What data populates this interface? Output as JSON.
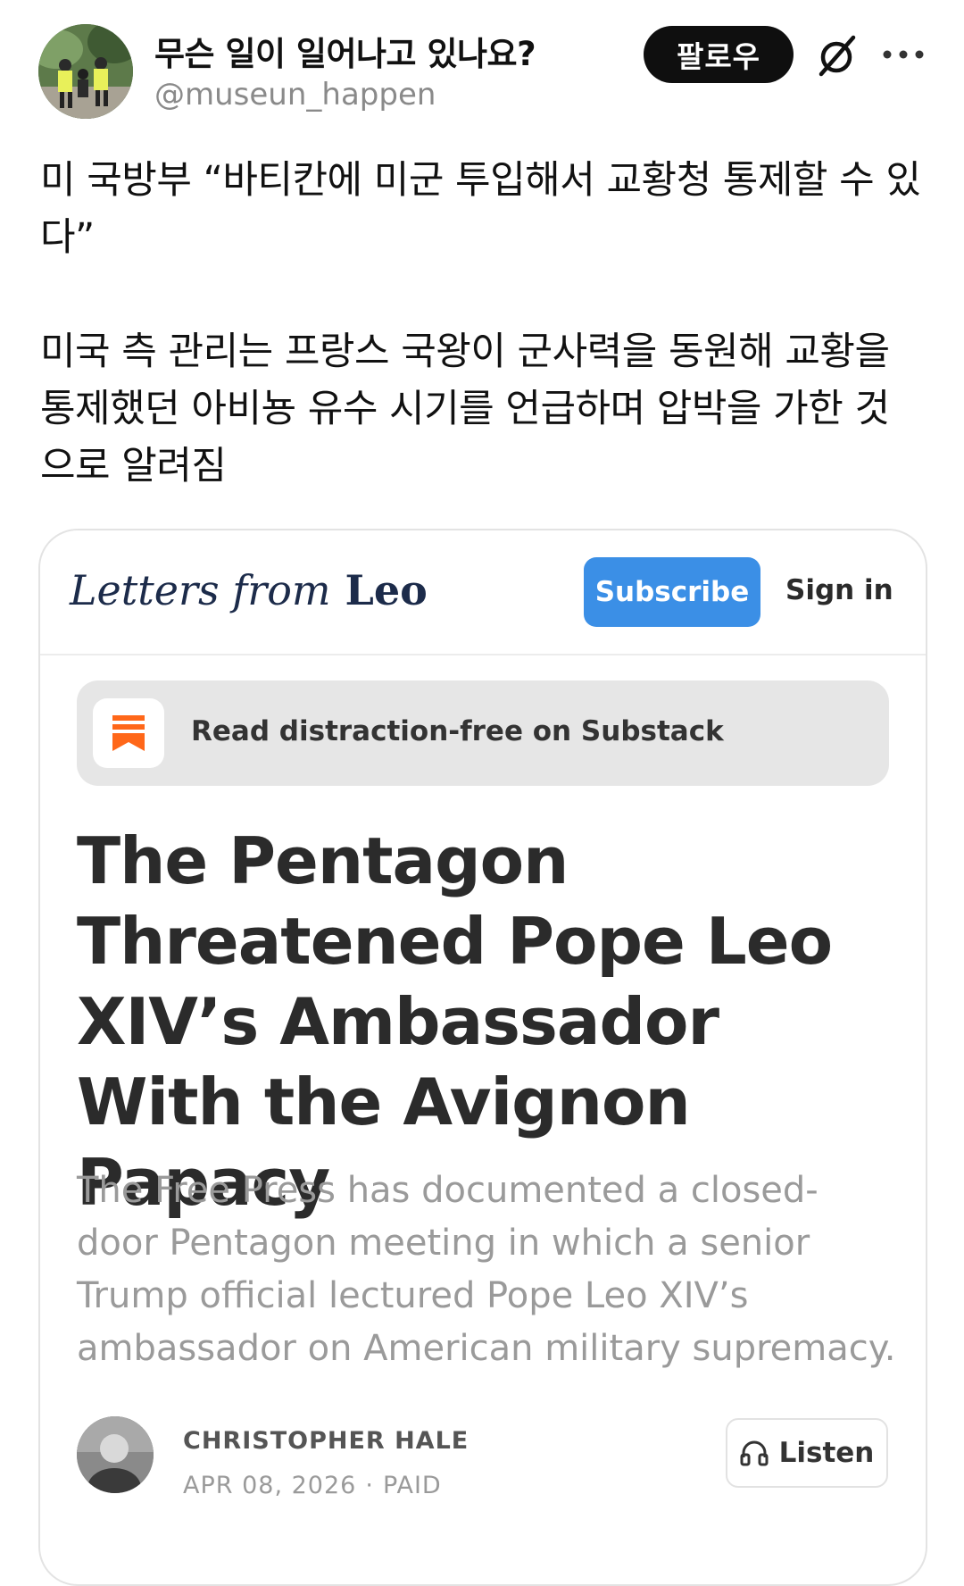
{
  "post": {
    "display_name": "무슨 일이 일어나고 있나요?",
    "handle": "@museun_happen",
    "follow_label": "팔로우",
    "text": "미 국방부 “바티칸에 미군 투입해서 교황청 통제할 수 있다”\n\n미국 측 관리는 프랑스 국왕이 군사력을 동원해 교황을 통제했던 아비뇽 유수 시기를 언급하며 압박을 가한 것으로 알려짐"
  },
  "card": {
    "brand_part1": "Letters ",
    "brand_part2": "from",
    "brand_part3": " Leo",
    "subscribe_label": "Subscribe",
    "signin_label": "Sign in",
    "substack_cta": "Read distraction-free on Substack",
    "headline": "The Pentagon Threatened Pope Leo XIV’s Ambassador With the Avignon Papacy",
    "dek": "The Free Press has documented a closed-door Pentagon meeting in which a senior Trump official lectured Pope Leo XIV’s ambassador on American military supremacy.",
    "author": "CHRISTOPHER HALE",
    "date": "APR 08, 2026",
    "separator": "·",
    "access": "PAID",
    "listen_label": "Listen"
  },
  "icons": {
    "grok": "grok-icon",
    "more": "more-icon",
    "substack": "substack-logo-icon",
    "headphones": "headphones-icon"
  },
  "colors": {
    "follow_bg": "#0f0f0f",
    "subscribe_bg": "#3b8fe6",
    "substack_orange": "#ff6719",
    "brand_navy": "#1c2b4a"
  }
}
